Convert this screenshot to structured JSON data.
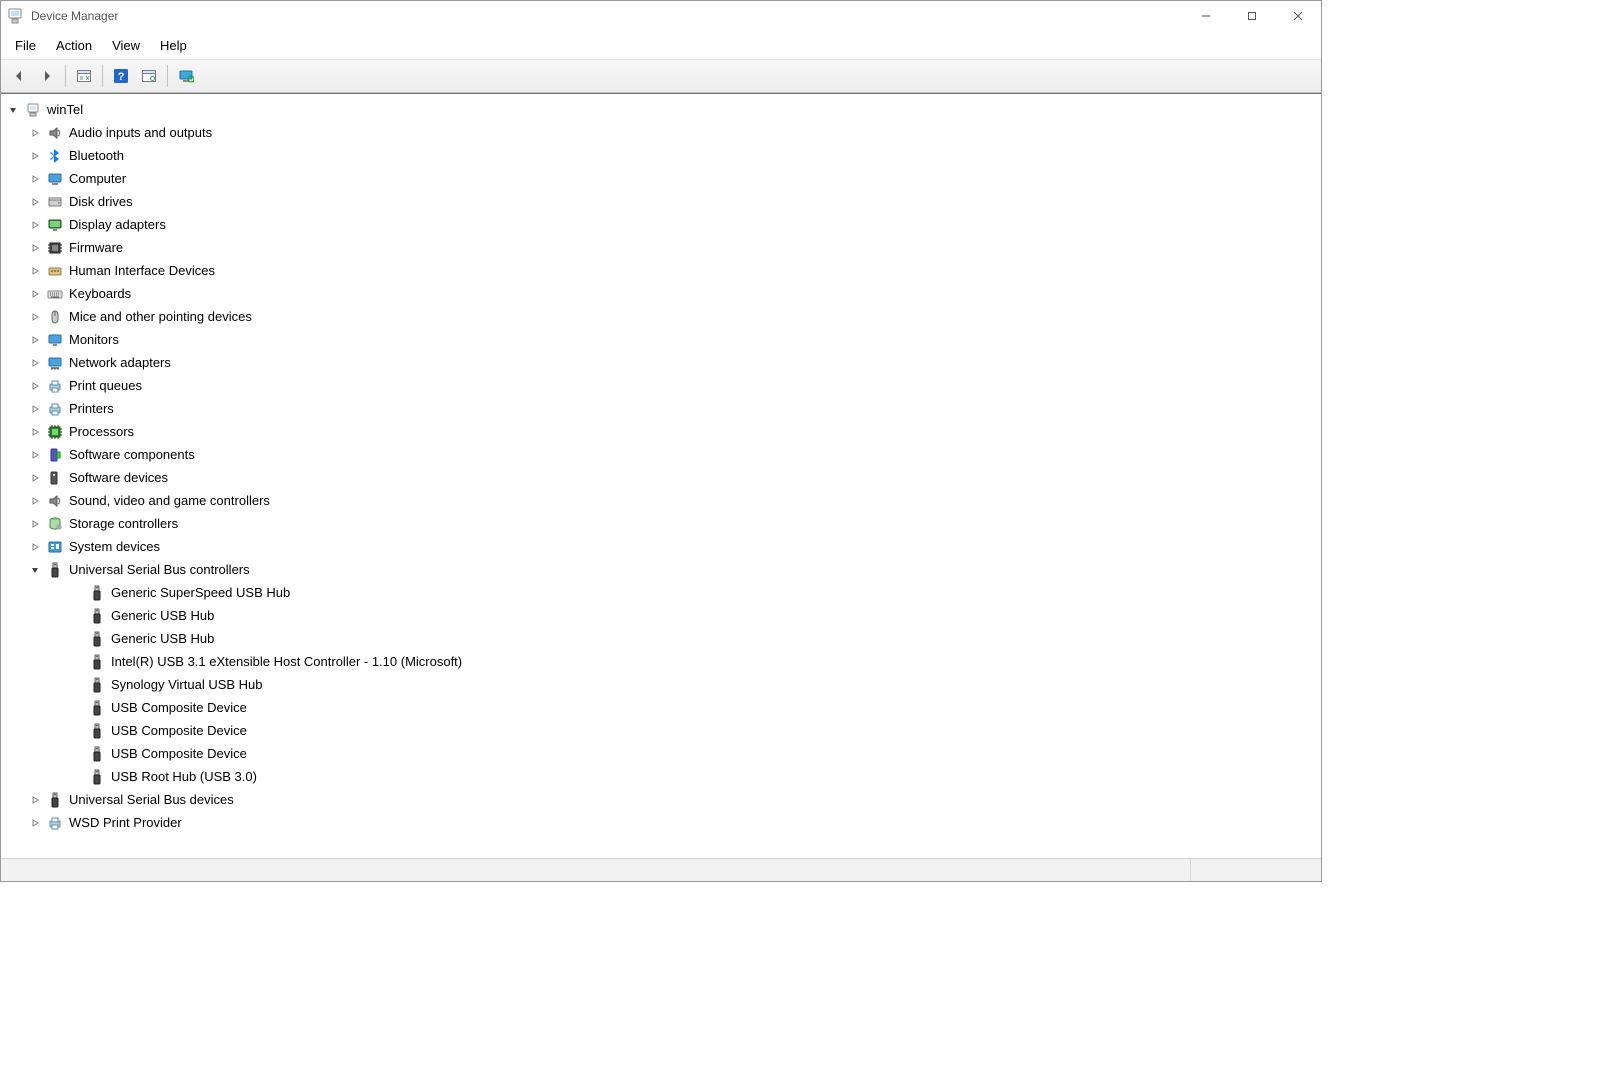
{
  "title": "Device Manager",
  "menus": {
    "file": "File",
    "action": "Action",
    "view": "View",
    "help": "Help"
  },
  "toolbar": {
    "back": "Back",
    "forward": "Forward",
    "show_hidden": "Show hidden",
    "help": "Help",
    "properties": "Properties",
    "scan": "Scan for hardware changes"
  },
  "tree": {
    "root": "winTel",
    "categories": [
      {
        "icon": "audio",
        "label": "Audio inputs and outputs",
        "expanded": false
      },
      {
        "icon": "bluetooth",
        "label": "Bluetooth",
        "expanded": false
      },
      {
        "icon": "computer",
        "label": "Computer",
        "expanded": false
      },
      {
        "icon": "disk",
        "label": "Disk drives",
        "expanded": false
      },
      {
        "icon": "display",
        "label": "Display adapters",
        "expanded": false
      },
      {
        "icon": "firmware",
        "label": "Firmware",
        "expanded": false
      },
      {
        "icon": "hid",
        "label": "Human Interface Devices",
        "expanded": false
      },
      {
        "icon": "keyboard",
        "label": "Keyboards",
        "expanded": false
      },
      {
        "icon": "mouse",
        "label": "Mice and other pointing devices",
        "expanded": false
      },
      {
        "icon": "monitor",
        "label": "Monitors",
        "expanded": false
      },
      {
        "icon": "network",
        "label": "Network adapters",
        "expanded": false
      },
      {
        "icon": "printq",
        "label": "Print queues",
        "expanded": false
      },
      {
        "icon": "printer",
        "label": "Printers",
        "expanded": false
      },
      {
        "icon": "cpu",
        "label": "Processors",
        "expanded": false
      },
      {
        "icon": "swcomp",
        "label": "Software components",
        "expanded": false
      },
      {
        "icon": "swdev",
        "label": "Software devices",
        "expanded": false
      },
      {
        "icon": "audio",
        "label": "Sound, video and game controllers",
        "expanded": false
      },
      {
        "icon": "storage",
        "label": "Storage controllers",
        "expanded": false
      },
      {
        "icon": "system",
        "label": "System devices",
        "expanded": false
      },
      {
        "icon": "usb",
        "label": "Universal Serial Bus controllers",
        "expanded": true,
        "children": [
          {
            "icon": "usb",
            "label": "Generic SuperSpeed USB Hub"
          },
          {
            "icon": "usb",
            "label": "Generic USB Hub"
          },
          {
            "icon": "usb",
            "label": "Generic USB Hub"
          },
          {
            "icon": "usb",
            "label": "Intel(R) USB 3.1 eXtensible Host Controller - 1.10 (Microsoft)"
          },
          {
            "icon": "usb",
            "label": "Synology Virtual USB Hub"
          },
          {
            "icon": "usb",
            "label": "USB Composite Device"
          },
          {
            "icon": "usb",
            "label": "USB Composite Device"
          },
          {
            "icon": "usb",
            "label": "USB Composite Device"
          },
          {
            "icon": "usb",
            "label": "USB Root Hub (USB 3.0)"
          }
        ]
      },
      {
        "icon": "usb",
        "label": "Universal Serial Bus devices",
        "expanded": false
      },
      {
        "icon": "wsd",
        "label": "WSD Print Provider",
        "expanded": false
      }
    ]
  },
  "colors": {
    "bt": "#0a7cff",
    "help_bg": "#2167c9"
  }
}
